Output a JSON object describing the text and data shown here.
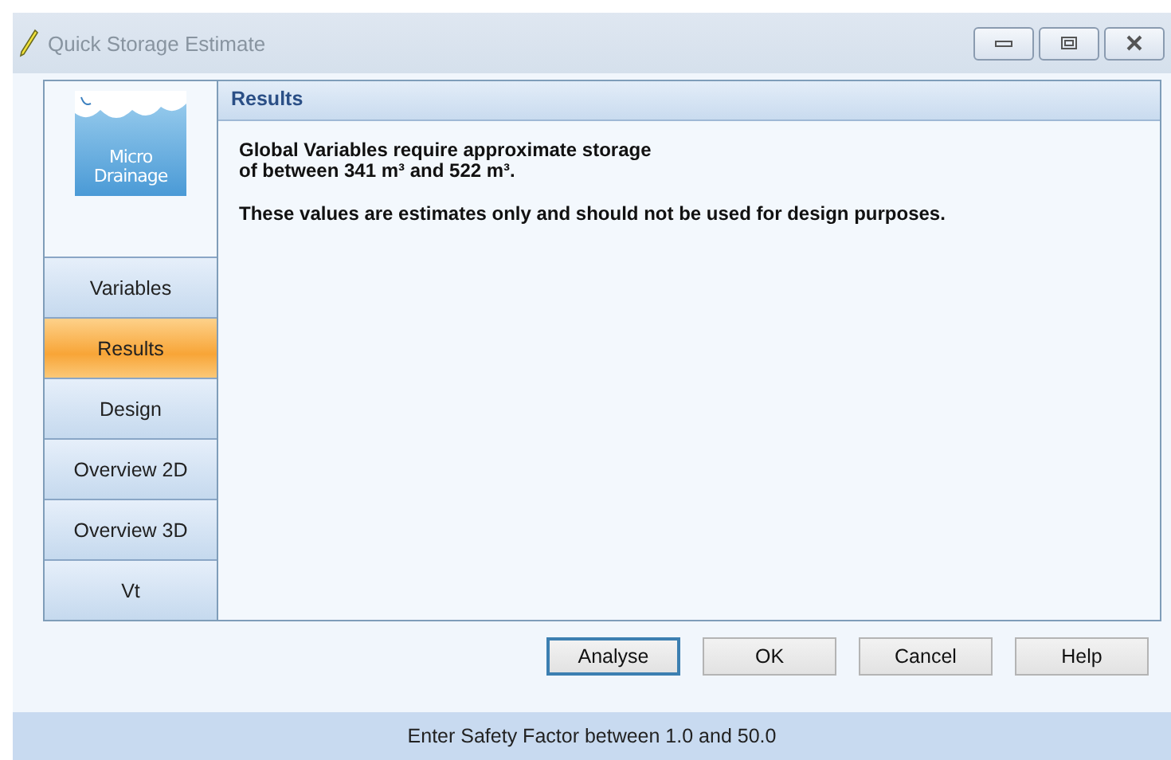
{
  "window": {
    "title": "Quick Storage Estimate"
  },
  "logo": {
    "lines": [
      "Micro",
      "Drainage"
    ]
  },
  "sidebar": {
    "items": [
      {
        "label": "Variables",
        "selected": false
      },
      {
        "label": "Results",
        "selected": true
      },
      {
        "label": "Design",
        "selected": false
      },
      {
        "label": "Overview 2D",
        "selected": false
      },
      {
        "label": "Overview 3D",
        "selected": false
      },
      {
        "label": "Vt",
        "selected": false
      }
    ]
  },
  "panel": {
    "title": "Results",
    "paragraphs": [
      "**Global Variables require approximate storage**\n**of between 341 m³ and 522 m³.**",
      "**These values are estimates only and should not be used for design purposes.**"
    ]
  },
  "buttons": [
    {
      "label": "Analyse",
      "default": true
    },
    {
      "label": "OK",
      "default": false
    },
    {
      "label": "Cancel",
      "default": false
    },
    {
      "label": "Help",
      "default": false
    }
  ],
  "status_bar": "Enter Safety Factor between 1.0 and 50.0"
}
